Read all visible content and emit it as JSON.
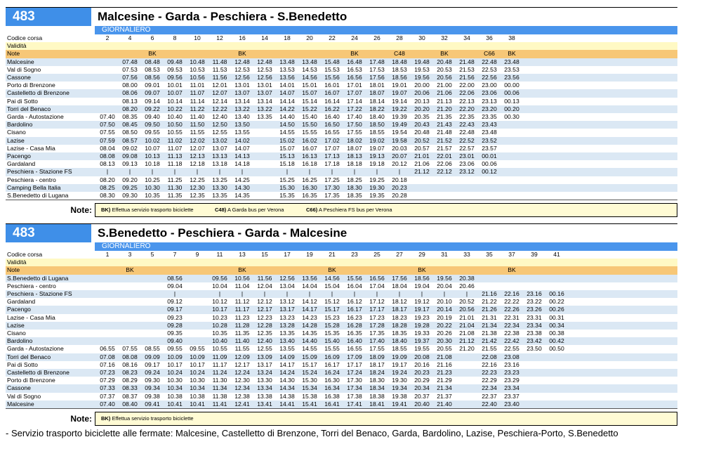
{
  "tables": [
    {
      "route": "483",
      "title": "Malcesine - Garda - Peschiera - S.Benedetto",
      "service": "GIORNALIERO",
      "labels": {
        "code": "Codice corsa",
        "validity": "Validità",
        "notes": "Note"
      },
      "codes": [
        "2",
        "4",
        "6",
        "8",
        "10",
        "12",
        "16",
        "14",
        "18",
        "20",
        "22",
        "24",
        "26",
        "28",
        "30",
        "32",
        "34",
        "36",
        "38"
      ],
      "notes": [
        "",
        "",
        "BK",
        "",
        "",
        "",
        "BK",
        "",
        "",
        "",
        "",
        "BK",
        "",
        "C48",
        "",
        "BK",
        "",
        "C66",
        "BK"
      ],
      "stops": [
        {
          "name": "Malcesine",
          "times": [
            "",
            "07.48",
            "08.48",
            "09.48",
            "10.48",
            "11.48",
            "12.48",
            "12.48",
            "13.48",
            "13.48",
            "15.48",
            "16.48",
            "17.48",
            "18.48",
            "19.48",
            "20.48",
            "21.48",
            "22.48",
            "23.48"
          ]
        },
        {
          "name": "Val di Sogno",
          "times": [
            "",
            "07.53",
            "08.53",
            "09.53",
            "10.53",
            "11.53",
            "12.53",
            "12.53",
            "13.53",
            "14.53",
            "15.53",
            "16.53",
            "17.53",
            "18.53",
            "19.53",
            "20.53",
            "21.53",
            "22.53",
            "23.53"
          ]
        },
        {
          "name": "Cassone",
          "times": [
            "",
            "07.56",
            "08.56",
            "09.56",
            "10.56",
            "11.56",
            "12.56",
            "12.56",
            "13.56",
            "14.56",
            "15.56",
            "16.56",
            "17.56",
            "18.56",
            "19.56",
            "20.56",
            "21.56",
            "22.56",
            "23.56"
          ]
        },
        {
          "name": "Porto di Brenzone",
          "times": [
            "",
            "08.00",
            "09.01",
            "10.01",
            "11.01",
            "12.01",
            "13.01",
            "13.01",
            "14.01",
            "15.01",
            "16.01",
            "17.01",
            "18.01",
            "19.01",
            "20.00",
            "21.00",
            "22.00",
            "23.00",
            "00.00"
          ]
        },
        {
          "name": "Castelletto di Brenzone",
          "times": [
            "",
            "08.06",
            "09.07",
            "10.07",
            "11.07",
            "12.07",
            "13.07",
            "13.07",
            "14.07",
            "15.07",
            "16.07",
            "17.07",
            "18.07",
            "19.07",
            "20.06",
            "21.06",
            "22.06",
            "23.06",
            "00.06"
          ]
        },
        {
          "name": "Pai di Sotto",
          "times": [
            "",
            "08.13",
            "09.14",
            "10.14",
            "11.14",
            "12.14",
            "13.14",
            "13.14",
            "14.14",
            "15.14",
            "16.14",
            "17.14",
            "18.14",
            "19.14",
            "20.13",
            "21.13",
            "22.13",
            "23.13",
            "00.13"
          ]
        },
        {
          "name": "Torri del Benaco",
          "times": [
            "",
            "08.20",
            "09.22",
            "10.22",
            "11.22",
            "12.22",
            "13.22",
            "13.22",
            "14.22",
            "15.22",
            "16.22",
            "17.22",
            "18.22",
            "19.22",
            "20.20",
            "21.20",
            "22.20",
            "23.20",
            "00.20"
          ]
        },
        {
          "name": "Garda - Autostazione",
          "times": [
            "07.40",
            "08.35",
            "09.40",
            "10.40",
            "11.40",
            "12.40",
            "13.40",
            "13.35",
            "14.40",
            "15.40",
            "16.40",
            "17.40",
            "18.40",
            "19.39",
            "20.35",
            "21.35",
            "22.35",
            "23.35",
            "00.30"
          ]
        },
        {
          "name": "Bardolino",
          "times": [
            "07.50",
            "08.45",
            "09.50",
            "10.50",
            "11.50",
            "12.50",
            "13.50",
            "",
            "14.50",
            "15.50",
            "16.50",
            "17.50",
            "18.50",
            "19.49",
            "20.43",
            "21.43",
            "22.43",
            "23.43",
            ""
          ]
        },
        {
          "name": "Cisano",
          "times": [
            "07.55",
            "08.50",
            "09.55",
            "10.55",
            "11.55",
            "12.55",
            "13.55",
            "",
            "14.55",
            "15.55",
            "16.55",
            "17.55",
            "18.55",
            "19.54",
            "20.48",
            "21.48",
            "22.48",
            "23.48",
            ""
          ]
        },
        {
          "name": "Lazise",
          "times": [
            "07.59",
            "08.57",
            "10.02",
            "11.02",
            "12.02",
            "13.02",
            "14.02",
            "",
            "15.02",
            "16.02",
            "17.02",
            "18.02",
            "19.02",
            "19.58",
            "20.52",
            "21.52",
            "22.52",
            "23.52",
            ""
          ]
        },
        {
          "name": "Lazise - Casa Mia",
          "times": [
            "08.04",
            "09.02",
            "10.07",
            "11.07",
            "12.07",
            "13.07",
            "14.07",
            "",
            "15.07",
            "16.07",
            "17.07",
            "18.07",
            "19.07",
            "20.03",
            "20.57",
            "21.57",
            "22.57",
            "23.57",
            ""
          ]
        },
        {
          "name": "Pacengo",
          "times": [
            "08.08",
            "09.08",
            "10.13",
            "11.13",
            "12.13",
            "13.13",
            "14.13",
            "",
            "15.13",
            "16.13",
            "17.13",
            "18.13",
            "19.13",
            "20.07",
            "21.01",
            "22.01",
            "23.01",
            "00.01",
            ""
          ]
        },
        {
          "name": "Gardaland",
          "times": [
            "08.13",
            "09.13",
            "10.18",
            "11.18",
            "12.18",
            "13.18",
            "14.18",
            "",
            "15.18",
            "16.18",
            "17.18",
            "18.18",
            "19.18",
            "20.12",
            "21.06",
            "22.06",
            "23.06",
            "00.06",
            ""
          ]
        },
        {
          "name": "Peschiera - Stazione FS",
          "times": [
            "|",
            "|",
            "|",
            "|",
            "|",
            "|",
            "|",
            "",
            "|",
            "|",
            "|",
            "|",
            "|",
            "|",
            "21.12",
            "22.12",
            "23.12",
            "00.12",
            ""
          ]
        },
        {
          "name": "Peschiera - centro",
          "times": [
            "08.20",
            "09.20",
            "10.25",
            "11.25",
            "12.25",
            "13.25",
            "14.25",
            "",
            "15.25",
            "16.25",
            "17.25",
            "18.25",
            "19.25",
            "20.18",
            "",
            "",
            "",
            "",
            ""
          ]
        },
        {
          "name": "Camping Bella Italia",
          "times": [
            "08.25",
            "09.25",
            "10.30",
            "11.30",
            "12.30",
            "13.30",
            "14.30",
            "",
            "15.30",
            "16.30",
            "17.30",
            "18.30",
            "19.30",
            "20.23",
            "",
            "",
            "",
            "",
            ""
          ]
        },
        {
          "name": "S.Benedetto di Lugana",
          "times": [
            "08.30",
            "09.30",
            "10.35",
            "11.35",
            "12.35",
            "13.35",
            "14.35",
            "",
            "15.35",
            "16.35",
            "17.35",
            "18.35",
            "19.35",
            "20.28",
            "",
            "",
            "",
            "",
            ""
          ]
        }
      ],
      "legend_label": "Note:",
      "legend": [
        {
          "code": "BK)",
          "text": "Effettua servizio trasporto biciclette"
        },
        {
          "code": "C48)",
          "text": "A Garda bus per Verona"
        },
        {
          "code": "C66)",
          "text": "A Peschiera FS bus per Verona"
        }
      ]
    },
    {
      "route": "483",
      "title": "S.Benedetto - Peschiera - Garda - Malcesine",
      "service": "GIORNALIERO",
      "labels": {
        "code": "Codice corsa",
        "validity": "Validità",
        "notes": "Note"
      },
      "codes": [
        "1",
        "3",
        "5",
        "7",
        "9",
        "11",
        "13",
        "15",
        "17",
        "19",
        "21",
        "23",
        "25",
        "27",
        "29",
        "31",
        "33",
        "35",
        "37",
        "39",
        "41"
      ],
      "notes": [
        "",
        "BK",
        "",
        "",
        "",
        "",
        "BK",
        "",
        "",
        "",
        "BK",
        "",
        "",
        "",
        "BK",
        "",
        "",
        "",
        "BK",
        "",
        ""
      ],
      "stops": [
        {
          "name": "S.Benedetto di Lugana",
          "times": [
            "",
            "",
            "",
            "08.56",
            "",
            "09.56",
            "10.56",
            "11.56",
            "12.56",
            "13.56",
            "14.56",
            "15.56",
            "16.56",
            "17.56",
            "18.56",
            "19.56",
            "20.38",
            "",
            "",
            "",
            ""
          ]
        },
        {
          "name": "Peschiera - centro",
          "times": [
            "",
            "",
            "",
            "09.04",
            "",
            "10.04",
            "11.04",
            "12.04",
            "13.04",
            "14.04",
            "15.04",
            "16.04",
            "17.04",
            "18.04",
            "19.04",
            "20.04",
            "20.46",
            "",
            "",
            "",
            ""
          ]
        },
        {
          "name": "Peschiera - Stazione FS",
          "times": [
            "",
            "",
            "",
            "|",
            "",
            "|",
            "|",
            "|",
            "|",
            "|",
            "|",
            "|",
            "|",
            "|",
            "|",
            "|",
            "|",
            "21.16",
            "22.16",
            "23.16",
            "00.16"
          ]
        },
        {
          "name": "Gardaland",
          "times": [
            "",
            "",
            "",
            "09.12",
            "",
            "10.12",
            "11.12",
            "12.12",
            "13.12",
            "14.12",
            "15.12",
            "16.12",
            "17.12",
            "18.12",
            "19.12",
            "20.10",
            "20.52",
            "21.22",
            "22.22",
            "23.22",
            "00.22"
          ]
        },
        {
          "name": "Pacengo",
          "times": [
            "",
            "",
            "",
            "09.17",
            "",
            "10.17",
            "11.17",
            "12.17",
            "13.17",
            "14.17",
            "15.17",
            "16.17",
            "17.17",
            "18.17",
            "19.17",
            "20.14",
            "20.56",
            "21.26",
            "22.26",
            "23.26",
            "00.26"
          ]
        },
        {
          "name": "Lazise - Casa Mia",
          "times": [
            "",
            "",
            "",
            "09.23",
            "",
            "10.23",
            "11.23",
            "12.23",
            "13.23",
            "14.23",
            "15.23",
            "16.23",
            "17.23",
            "18.23",
            "19.23",
            "20.19",
            "21.01",
            "21.31",
            "22.31",
            "23.31",
            "00.31"
          ]
        },
        {
          "name": "Lazise",
          "times": [
            "",
            "",
            "",
            "09.28",
            "",
            "10.28",
            "11.28",
            "12.28",
            "13.28",
            "14.28",
            "15.28",
            "16.28",
            "17.28",
            "18.28",
            "19.28",
            "20.22",
            "21.04",
            "21.34",
            "22.34",
            "23.34",
            "00.34"
          ]
        },
        {
          "name": "Cisano",
          "times": [
            "",
            "",
            "",
            "09.35",
            "",
            "10.35",
            "11.35",
            "12.35",
            "13.35",
            "14.35",
            "15.35",
            "16.35",
            "17.35",
            "18.35",
            "19.33",
            "20.26",
            "21.08",
            "21.38",
            "22.38",
            "23.38",
            "00.38"
          ]
        },
        {
          "name": "Bardolino",
          "times": [
            "",
            "",
            "",
            "09.40",
            "",
            "10.40",
            "11.40",
            "12.40",
            "13.40",
            "14.40",
            "15.40",
            "16.40",
            "17.40",
            "18.40",
            "19.37",
            "20.30",
            "21.12",
            "21.42",
            "22.42",
            "23.42",
            "00.42"
          ]
        },
        {
          "name": "Garda - Autostazione",
          "times": [
            "06.55",
            "07.55",
            "08.55",
            "09.55",
            "09.55",
            "10.55",
            "11.55",
            "12.55",
            "13.55",
            "14.55",
            "15.55",
            "16.55",
            "17.55",
            "18.55",
            "19.55",
            "20.55",
            "21.20",
            "21.55",
            "22.55",
            "23.50",
            "00.50"
          ]
        },
        {
          "name": "Torri del Benaco",
          "times": [
            "07.08",
            "08.08",
            "09.09",
            "10.09",
            "10.09",
            "11.09",
            "12.09",
            "13.09",
            "14.09",
            "15.09",
            "16.09",
            "17.09",
            "18.09",
            "19.09",
            "20.08",
            "21.08",
            "",
            "22.08",
            "23.08",
            "",
            ""
          ]
        },
        {
          "name": "Pai di Sotto",
          "times": [
            "07.16",
            "08.16",
            "09.17",
            "10.17",
            "10.17",
            "11.17",
            "12.17",
            "13.17",
            "14.17",
            "15.17",
            "16.17",
            "17.17",
            "18.17",
            "19.17",
            "20.16",
            "21.16",
            "",
            "22.16",
            "23.16",
            "",
            ""
          ]
        },
        {
          "name": "Castelletto di Brenzone",
          "times": [
            "07.23",
            "08.23",
            "09.24",
            "10.24",
            "10.24",
            "11.24",
            "12.24",
            "13.24",
            "14.24",
            "15.24",
            "16.24",
            "17.24",
            "18.24",
            "19.24",
            "20.23",
            "21.23",
            "",
            "22.23",
            "23.23",
            "",
            ""
          ]
        },
        {
          "name": "Porto di Brenzone",
          "times": [
            "07.29",
            "08.29",
            "09.30",
            "10.30",
            "10.30",
            "11.30",
            "12.30",
            "13.30",
            "14.30",
            "15.30",
            "16.30",
            "17.30",
            "18.30",
            "19.30",
            "20.29",
            "21.29",
            "",
            "22.29",
            "23.29",
            "",
            ""
          ]
        },
        {
          "name": "Cassone",
          "times": [
            "07.33",
            "08.33",
            "09.34",
            "10.34",
            "10.34",
            "11.34",
            "12.34",
            "13.34",
            "14.34",
            "15.34",
            "16.34",
            "17.34",
            "18.34",
            "19.34",
            "20.34",
            "21.34",
            "",
            "22.34",
            "23.34",
            "",
            ""
          ]
        },
        {
          "name": "Val di Sogno",
          "times": [
            "07.37",
            "08.37",
            "09.38",
            "10.38",
            "10.38",
            "11.38",
            "12.38",
            "13.38",
            "14.38",
            "15.38",
            "16.38",
            "17.38",
            "18.38",
            "19.38",
            "20.37",
            "21.37",
            "",
            "22.37",
            "23.37",
            "",
            ""
          ]
        },
        {
          "name": "Malcesine",
          "times": [
            "07.40",
            "08.40",
            "09.41",
            "10.41",
            "10.41",
            "11.41",
            "12.41",
            "13.41",
            "14.41",
            "15.41",
            "16.41",
            "17.41",
            "18.41",
            "19.41",
            "20.40",
            "21.40",
            "",
            "22.40",
            "23.40",
            "",
            ""
          ]
        }
      ],
      "legend_label": "Note:",
      "legend": [
        {
          "code": "BK)",
          "text": "Effettua servizio trasporto biciclette"
        }
      ]
    }
  ],
  "footnote": "-  Servizio trasporto biciclette alle fermate: Malcesine, Castelletto di Brenzone, Torri del Benaco, Garda, Bardolino, Lazise, Peschiera-Porto, S.Benedetto"
}
